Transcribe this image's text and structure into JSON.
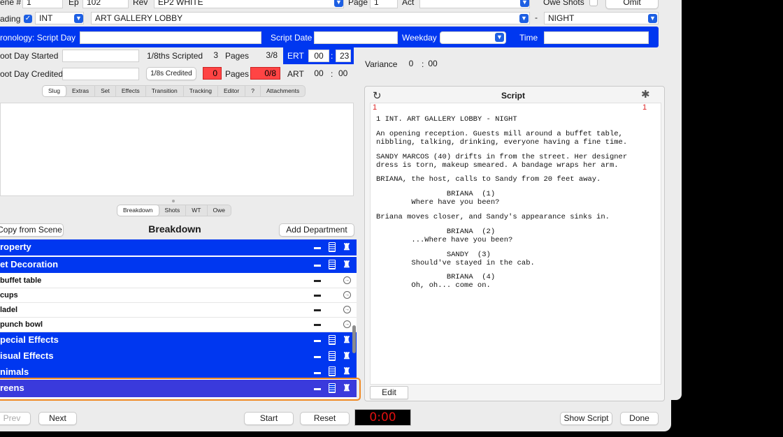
{
  "header": {
    "scene_label": "ene #",
    "scene_value": "1",
    "ep_label": "Ep",
    "ep_value": "102",
    "rev_label": "Rev",
    "rev_value": "EP2 WHITE",
    "page_label": "Page",
    "page_value": "1",
    "act_label": "Act",
    "act_value": "",
    "owe_shots_label": "Owe Shots",
    "omit_label": "Omit"
  },
  "heading": {
    "label": "ading",
    "checked": true,
    "int_ext": "INT",
    "location": "ART GALLERY LOBBY",
    "dash": "-",
    "time_of_day": "NIGHT"
  },
  "chronology": {
    "label": "ronology:  Script Day",
    "script_day": "",
    "script_date_label": "Script Date",
    "script_date": "",
    "weekday_label": "Weekday",
    "weekday": "",
    "time_label": "Time",
    "time": ""
  },
  "shoot": {
    "started_label": "oot Day Started",
    "started_value": "",
    "credited_label": "oot Day Credited",
    "credited_value": "",
    "eighths_scripted_label": "1/8ths Scripted",
    "eighths_scripted_value": "3",
    "pages_label": "Pages",
    "pages_scripted_value": "3/8",
    "credited_btn_label": "1/8s Credited",
    "eighths_credited_value": "0",
    "pages_credited_value": "0/8",
    "ert_label": "ERT",
    "ert_min": "00",
    "ert_sec": "23",
    "art_label": "ART",
    "art_min": "00",
    "art_sec": "00",
    "variance_label": "Variance",
    "variance_min": "0",
    "variance_sec": "00",
    "colon": ":"
  },
  "top_tabs": [
    "Slug",
    "Extras",
    "Set",
    "Effects",
    "Transition",
    "Tracking",
    "Editor",
    "?",
    "Attachments"
  ],
  "bottom_tabs": [
    "Breakdown",
    "Shots",
    "WT",
    "Owe"
  ],
  "breakdown": {
    "title": "Breakdown",
    "copy_button": "Copy from Scene",
    "add_button": "Add Department",
    "rows": [
      {
        "type": "dept",
        "name": "roperty"
      },
      {
        "type": "dept",
        "name": "et Decoration"
      },
      {
        "type": "item",
        "name": "buffet table"
      },
      {
        "type": "item",
        "name": "cups"
      },
      {
        "type": "item",
        "name": "ladel"
      },
      {
        "type": "item",
        "name": "punch bowl"
      },
      {
        "type": "dept",
        "name": "pecial Effects"
      },
      {
        "type": "dept",
        "name": "isual Effects"
      },
      {
        "type": "dept",
        "name": "nimals"
      },
      {
        "type": "dept",
        "name": "reens",
        "selected": true
      }
    ]
  },
  "script": {
    "title": "Script",
    "page_left": "1",
    "page_right": "1",
    "edit_button": "Edit",
    "lines": [
      "1 INT. ART GALLERY LOBBY - NIGHT",
      "An opening reception. Guests mill around a buffet table,",
      "nibbling, talking, drinking, everyone having a fine time.",
      "SANDY MARCOS (40) drifts in from the street. Her designer",
      "dress is torn, makeup smeared. A bandage wraps her arm.",
      "BRIANA, the host, calls to Sandy from 20 feet away.",
      "                BRIANA  (1)",
      "        Where have you been?",
      "Briana moves closer, and Sandy's appearance sinks in.",
      "                BRIANA  (2)",
      "        ...Where have you been?",
      "                SANDY  (3)",
      "        Should've stayed in the cab.",
      "                BRIANA  (4)",
      "        Oh, oh... come on."
    ]
  },
  "footer": {
    "prev_button": "Prev",
    "next_button": "Next",
    "start_button": "Start",
    "reset_button": "Reset",
    "timer": "0:00",
    "show_script_button": "Show Script",
    "done_button": "Done"
  },
  "colors": {
    "accent_blue": "#0037f0",
    "selection_orange": "#f08a24",
    "alert_red": "#ff4444"
  }
}
